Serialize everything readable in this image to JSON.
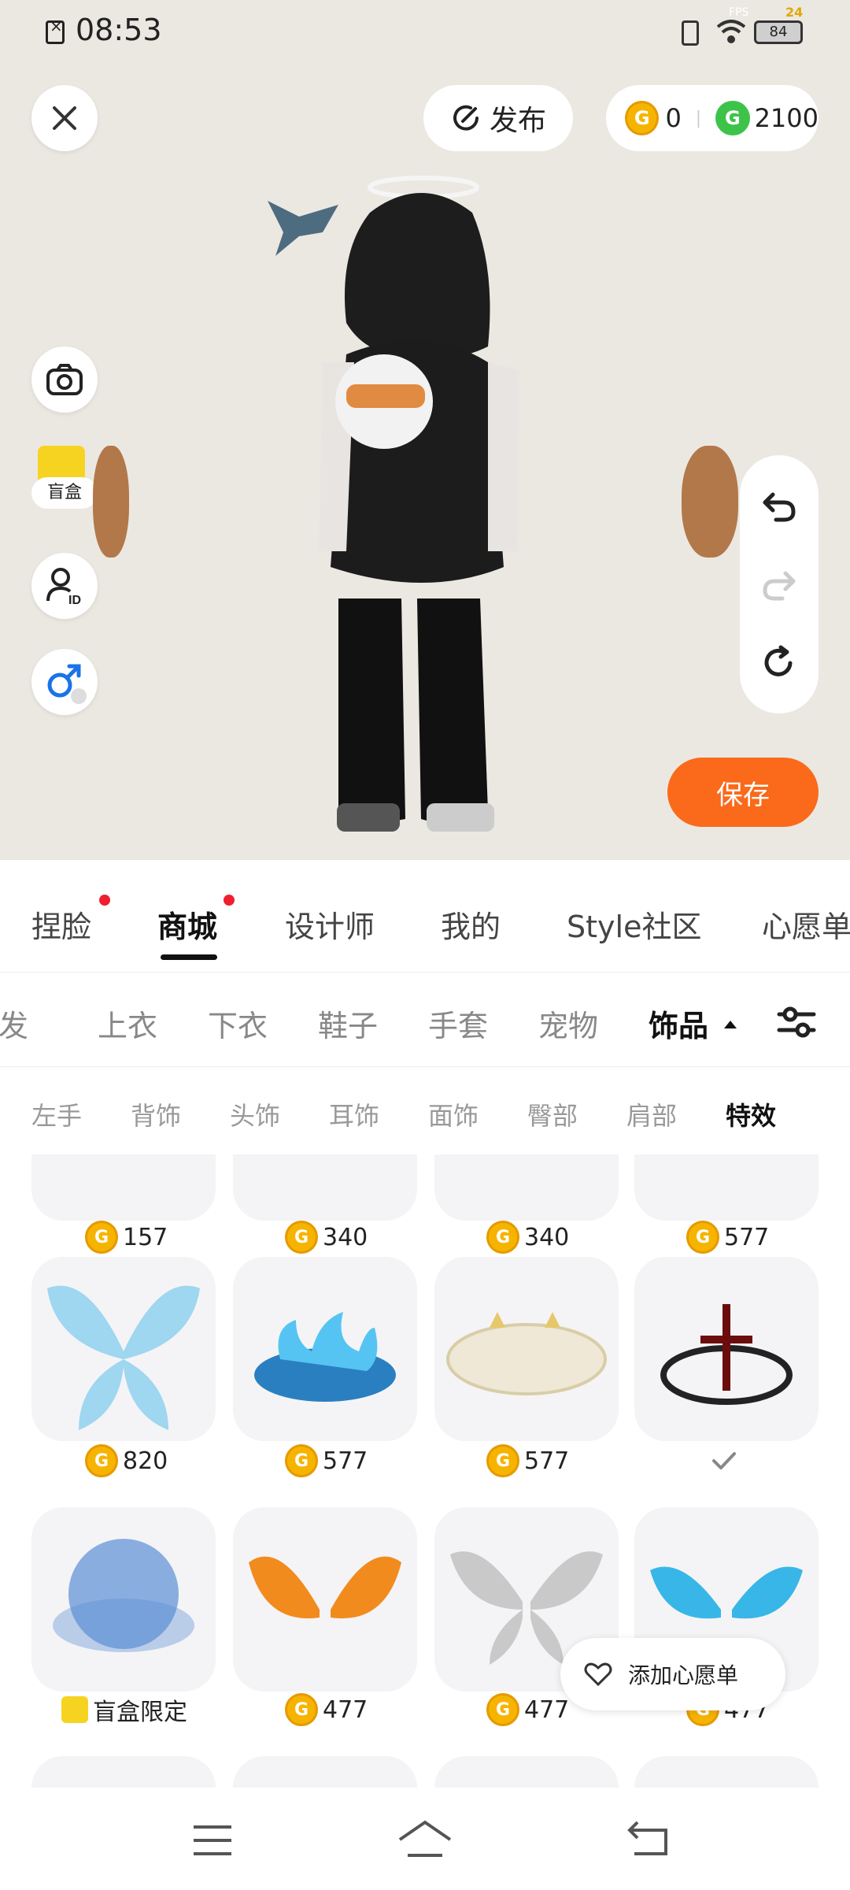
{
  "status_bar": {
    "time": "08:53",
    "battery": "84",
    "fps_label": "FPS",
    "fps_value": "24"
  },
  "header": {
    "publish_label": "发布",
    "coins": "0",
    "gems": "2100"
  },
  "left_tools": {
    "blind_box_label": "盲盒"
  },
  "save_label": "保存",
  "main_tabs": [
    {
      "label": "捏脸",
      "dot": true
    },
    {
      "label": "商城",
      "dot": true,
      "active": true
    },
    {
      "label": "设计师"
    },
    {
      "label": "我的"
    },
    {
      "label": "Style社区"
    },
    {
      "label": "心愿单"
    }
  ],
  "category_tabs": [
    "头发",
    "上衣",
    "下衣",
    "鞋子",
    "手套",
    "宠物",
    "饰品"
  ],
  "sub_tabs": [
    "左手",
    "背饰",
    "头饰",
    "耳饰",
    "面饰",
    "臀部",
    "肩部",
    "特效"
  ],
  "items": [
    {
      "price": "157"
    },
    {
      "price": "340"
    },
    {
      "price": "340"
    },
    {
      "price": "577"
    },
    {
      "price": "820"
    },
    {
      "price": "577"
    },
    {
      "price": "577"
    },
    {
      "price": "owned"
    },
    {
      "price": "盲盒限定"
    },
    {
      "price": "477"
    },
    {
      "price": "477"
    },
    {
      "price": "477"
    }
  ],
  "wishlist_label": "添加心愿单",
  "colors": {
    "accent": "#fa6a1a",
    "coin": "#f6b400",
    "gem": "#3ec34a",
    "dot": "#f01f2f"
  }
}
